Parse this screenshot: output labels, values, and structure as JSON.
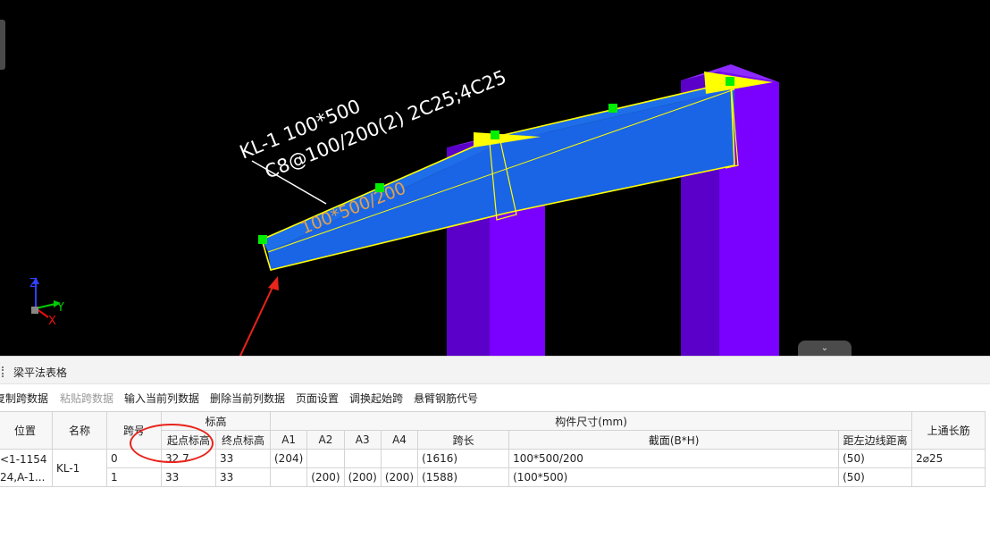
{
  "viewport": {
    "beam_label_line1": "KL-1 100*500",
    "beam_label_line2": "C8@100/200(2) 2C25;4C25",
    "section_label": "100*500/200",
    "axes": {
      "z": "Z",
      "y": "Y",
      "x": "X"
    },
    "colors": {
      "background": "#000000",
      "beam": "#1a64e6",
      "column": "#7a00ff",
      "outline": "#ffff00",
      "grip": "#00ee00",
      "annotation": "#e8241b"
    },
    "collapse_icon": "chevron-down-icon"
  },
  "panel": {
    "title": "梁平法表格",
    "toolbar": [
      {
        "label": "复制跨数据",
        "enabled": true
      },
      {
        "label": "粘贴跨数据",
        "enabled": false
      },
      {
        "label": "输入当前列数据",
        "enabled": true
      },
      {
        "label": "删除当前列数据",
        "enabled": true
      },
      {
        "label": "页面设置",
        "enabled": true
      },
      {
        "label": "调换起始跨",
        "enabled": true
      },
      {
        "label": "悬臂钢筋代号",
        "enabled": true
      }
    ],
    "table": {
      "headers": {
        "position": "位置",
        "name": "名称",
        "span_no": "跨号",
        "elevation": "标高",
        "start_elev": "起点标高",
        "end_elev": "终点标高",
        "dimensions": "构件尺寸(mm)",
        "a1": "A1",
        "a2": "A2",
        "a3": "A3",
        "a4": "A4",
        "span_len": "跨长",
        "section": "截面(B*H)",
        "edge_dist": "距左边线距离",
        "top_bar": "上通长筋"
      },
      "position_line1": "<1-1154",
      "position_line2": "24,A-1...",
      "name": "KL-1",
      "top_bar": "2⌀25",
      "rows": [
        {
          "span": "0",
          "start": "32.7",
          "end": "33",
          "a1": "(204)",
          "a2": "",
          "a3": "",
          "a4": "",
          "span_len": "(1616)",
          "section": "100*500/200",
          "edge": "(50)"
        },
        {
          "span": "1",
          "start": "33",
          "end": "33",
          "a1": "",
          "a2": "(200)",
          "a3": "(200)",
          "a4": "(200)",
          "span_len": "(1588)",
          "section": "(100*500)",
          "edge": "(50)"
        }
      ]
    }
  }
}
